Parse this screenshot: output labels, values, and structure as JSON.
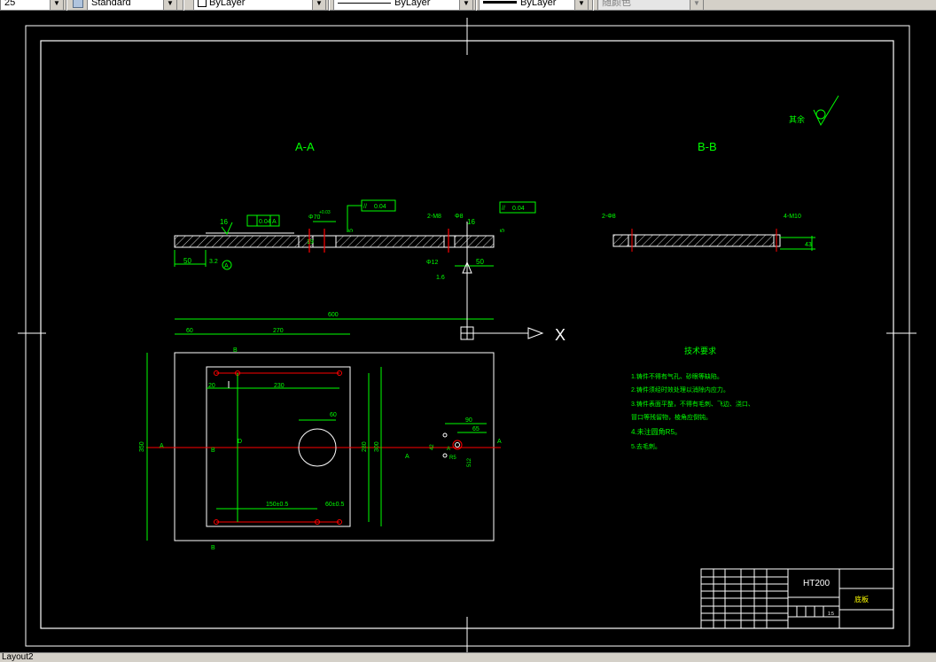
{
  "toolbar": {
    "scale_value": "25",
    "text_style": "Standard",
    "color": "ByLayer",
    "linetype": "ByLayer",
    "lineweight": "ByLayer",
    "plot_style": "随颜色"
  },
  "drawing": {
    "section_aa_title": "A-A",
    "section_bb_title": "B-B",
    "roughness_note": "其余",
    "dims": {
      "aa_16": "16",
      "aa_flat": "0.04",
      "aa_datum": "A",
      "aa_bore": "Φ70",
      "aa_bore_tol": "+0.03",
      "aa_5": "5",
      "aa_parallel": "0.04",
      "aa_2m8": "2-M8",
      "aa_phi8": "Φ8",
      "aa_right_16": "16",
      "aa_right_parallel": "0.04",
      "aa_50_left": "50",
      "aa_32": "3.2",
      "aa_datum_circle": "A",
      "aa_phi12": "Φ12",
      "aa_right_roughness": "1.6",
      "aa_50_right": "50",
      "aa_5_right": "5",
      "aa_19": "19",
      "bb_left_note": "2-Φ8",
      "bb_right_note": "4-M10",
      "bb_thk": "43",
      "plan_600": "600",
      "plan_60": "60",
      "plan_270": "270",
      "plan_B_top": "B",
      "plan_20": "20",
      "plan_230": "230",
      "plan_60_hole": "60",
      "plan_350": "350",
      "plan_280": "280",
      "plan_300": "300",
      "plan_A_left": "A",
      "plan_B_mid": "B",
      "plan_D": "D",
      "plan_150": "150±0.5",
      "plan_60_tol": "60±0.5",
      "plan_A_right": "A",
      "plan_90": "90",
      "plan_65": "65",
      "plan_42": "42",
      "plan_A_small": "A",
      "plan_R5": "R5",
      "plan_512": "512",
      "plan_B_bottom": "B",
      "plan_A_far": "A"
    },
    "tech_title": "技术要求",
    "tech_items": [
      "1.铸件不得有气孔、砂眼等缺陷。",
      "2.铸件须经时效处理以消除内应力。",
      "3.铸件表面平整，不得有毛刺、飞边、浇口、",
      "  冒口等残留物，棱角应倒钝。",
      "4.未注圆角R5。",
      "5.去毛刺。"
    ],
    "title_block": {
      "material": "HT200",
      "part_name": "底板",
      "scale_small": "1:5"
    }
  },
  "tabs": {
    "layout": "Layout2"
  }
}
